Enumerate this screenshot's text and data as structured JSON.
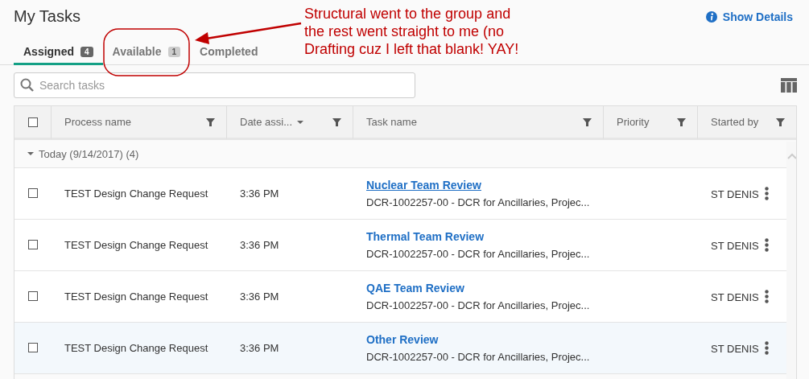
{
  "header": {
    "title": "My Tasks",
    "details_link": "Show Details"
  },
  "annotation": {
    "text": "Structural went to the group and\nthe rest went straight to me (no\nDrafting cuz I left that blank! YAY!"
  },
  "tabs": [
    {
      "label": "Assigned",
      "count": "4",
      "selected": true
    },
    {
      "label": "Available",
      "count": "1",
      "selected": false
    },
    {
      "label": "Completed",
      "selected": false
    }
  ],
  "search": {
    "placeholder": "Search tasks"
  },
  "table": {
    "select_all_checked": false,
    "columns": [
      {
        "label": "Process name",
        "sorted": false
      },
      {
        "label": "Date assi...",
        "sorted": true
      },
      {
        "label": "Task name",
        "sorted": false
      },
      {
        "label": "Priority",
        "sorted": false
      },
      {
        "label": "Started by",
        "sorted": false
      }
    ],
    "group": {
      "label": "Today (9/14/2017) (4)",
      "expanded": true
    },
    "rows": [
      {
        "checked": false,
        "process": "TEST Design Change Request",
        "date": "3:36 PM",
        "task": "Nuclear Team Review",
        "description": "DCR-1002257-00 - DCR for Ancillaries, Projec...",
        "started_by": "ST DENIS",
        "underlined": true,
        "highlighted": false
      },
      {
        "checked": false,
        "process": "TEST Design Change Request",
        "date": "3:36 PM",
        "task": "Thermal Team Review",
        "description": "DCR-1002257-00 - DCR for Ancillaries, Projec...",
        "started_by": "ST DENIS",
        "underlined": false,
        "highlighted": false
      },
      {
        "checked": false,
        "process": "TEST Design Change Request",
        "date": "3:36 PM",
        "task": "QAE Team Review",
        "description": "DCR-1002257-00 - DCR for Ancillaries, Projec...",
        "started_by": "ST DENIS",
        "underlined": false,
        "highlighted": false
      },
      {
        "checked": false,
        "process": "TEST Design Change Request",
        "date": "3:36 PM",
        "task": "Other Review",
        "description": "DCR-1002257-00 - DCR for Ancillaries, Projec...",
        "started_by": "ST DENIS",
        "underlined": false,
        "highlighted": true
      }
    ]
  }
}
